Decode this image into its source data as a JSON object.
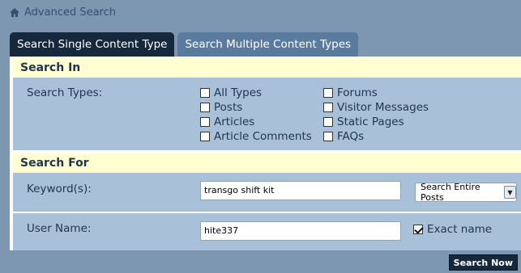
{
  "breadcrumb": {
    "label": "Advanced Search",
    "icon": "home-icon"
  },
  "tabs": [
    {
      "label": "Search Single Content Type",
      "active": true
    },
    {
      "label": "Search Multiple Content Types",
      "active": false
    }
  ],
  "search_in": {
    "heading": "Search In",
    "types_label": "Search Types:",
    "types": [
      {
        "label": "All Types",
        "checked": false
      },
      {
        "label": "Posts",
        "checked": false
      },
      {
        "label": "Articles",
        "checked": false
      },
      {
        "label": "Article Comments",
        "checked": false
      },
      {
        "label": "Forums",
        "checked": false
      },
      {
        "label": "Visitor Messages",
        "checked": false
      },
      {
        "label": "Static Pages",
        "checked": false
      },
      {
        "label": "FAQs",
        "checked": false
      }
    ]
  },
  "search_for": {
    "heading": "Search For",
    "keyword_label": "Keyword(s):",
    "keyword_value": "transgo shift kit",
    "scope_selected": "Search Entire Posts",
    "username_label": "User Name:",
    "username_value": "hite337",
    "exact_name_label": "Exact name",
    "exact_name_checked": true
  },
  "actions": {
    "search_label": "Search Now"
  },
  "colors": {
    "background": "#7d97b0",
    "row": "#a8c1d9",
    "section_head": "#ffffd1",
    "active_tab": "#16283b",
    "inactive_tab": "#5a7b9e"
  }
}
